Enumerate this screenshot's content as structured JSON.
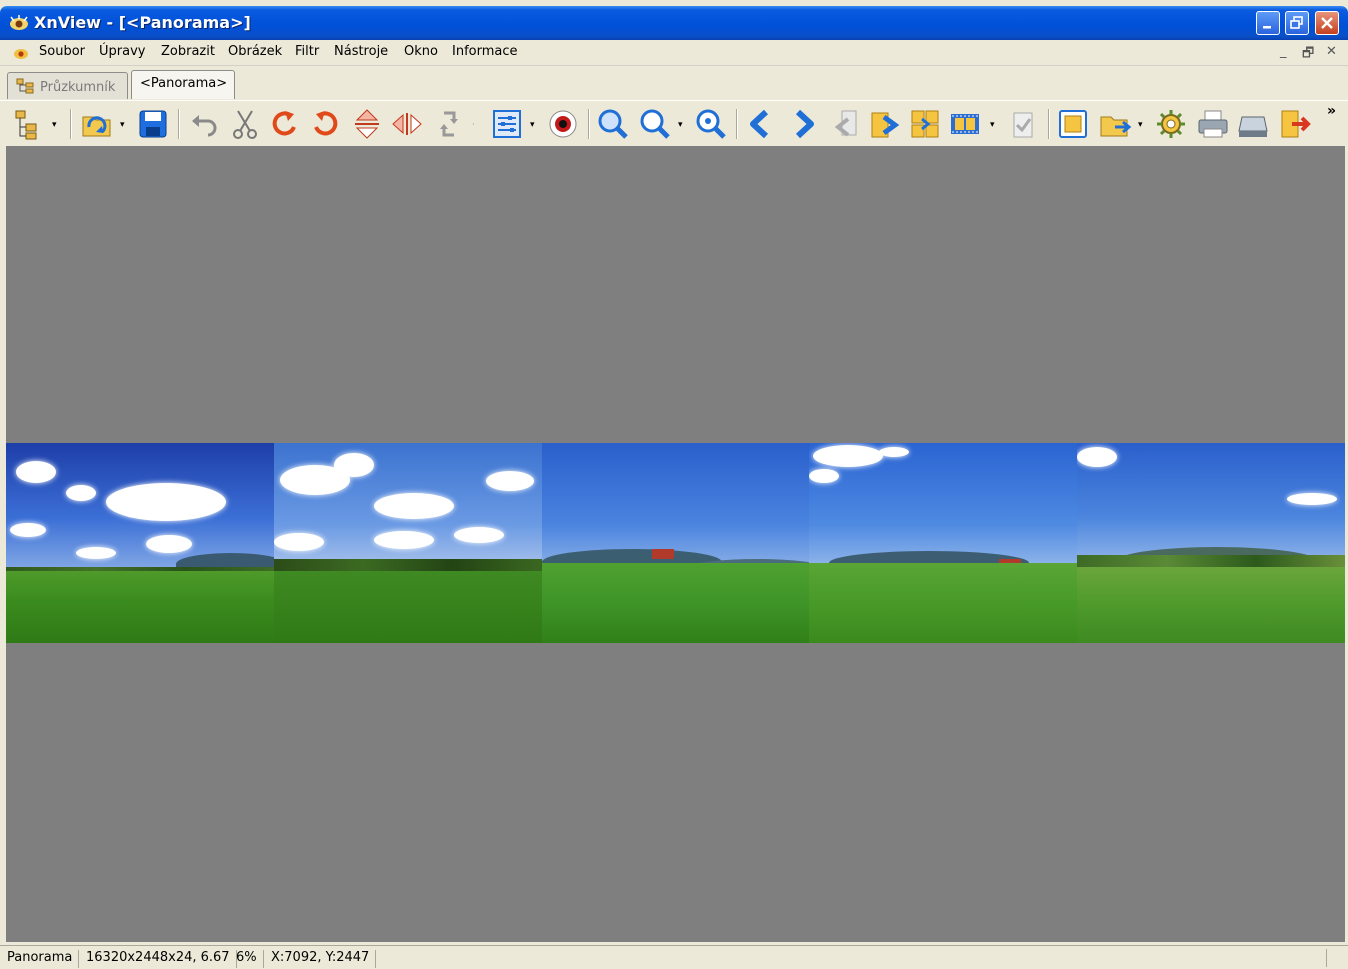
{
  "window": {
    "title": "XnView - [<Panorama>]"
  },
  "menubar": {
    "items": [
      "Soubor",
      "Úpravy",
      "Zobrazit",
      "Obrázek",
      "Filtr",
      "Nástroje",
      "Okno",
      "Informace"
    ],
    "mdi_controls": [
      "_",
      "🗗",
      "✕"
    ]
  },
  "tabs": [
    {
      "label": "Průzkumník",
      "active": false
    },
    {
      "label": "<Panorama>",
      "active": true
    }
  ],
  "toolbar": {
    "buttons": [
      "browser-icon",
      "open-icon",
      "save-icon",
      "undo-icon",
      "cut-icon",
      "rotate-left-icon",
      "rotate-right-icon",
      "flip-vertical-icon",
      "flip-horizontal-icon",
      "rotate-auto-icon",
      "adjust-icon",
      "red-eye-icon",
      "zoom-in-icon",
      "zoom-out-icon",
      "zoom-fit-icon",
      "previous-icon",
      "next-icon",
      "first-icon",
      "last-icon",
      "slideshow-icon",
      "filmstrip-icon",
      "ok-icon",
      "fullscreen-icon",
      "open-folder-icon",
      "settings-icon",
      "print-icon",
      "scan-icon",
      "exit-icon"
    ],
    "more": "»"
  },
  "viewer": {
    "background": "#7f7f7f"
  },
  "statusbar": {
    "name": "Panorama",
    "info": "16320x2448x24, 6.67",
    "zoom": "6%",
    "coords": "X:7092, Y:2447"
  }
}
